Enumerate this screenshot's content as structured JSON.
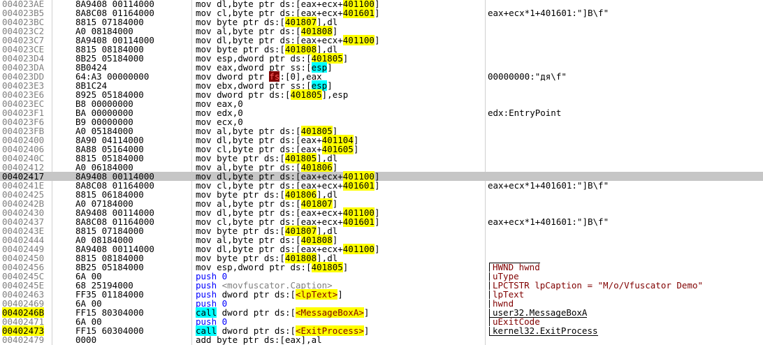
{
  "rows": [
    {
      "addr": "004023AE",
      "bytes": "8A9408 00114000",
      "mn": "mov",
      "ops": [
        [
          "reg",
          "dl"
        ],
        [
          "p",
          ","
        ],
        [
          "kw",
          "byte ptr "
        ],
        [
          "seg",
          "ds"
        ],
        [
          "p",
          ":["
        ],
        [
          "reg",
          "eax"
        ],
        [
          "p",
          "+"
        ],
        [
          "reg",
          "ecx"
        ],
        [
          "p",
          "+"
        ],
        [
          "addr",
          "401100"
        ],
        [
          "p",
          "]"
        ]
      ],
      "cmt": ""
    },
    {
      "addr": "004023B5",
      "bytes": "8A8C08 01164000",
      "mn": "mov",
      "ops": [
        [
          "reg",
          "cl"
        ],
        [
          "p",
          ","
        ],
        [
          "kw",
          "byte ptr "
        ],
        [
          "seg",
          "ds"
        ],
        [
          "p",
          ":["
        ],
        [
          "reg",
          "eax"
        ],
        [
          "p",
          "+"
        ],
        [
          "reg",
          "ecx"
        ],
        [
          "p",
          "+"
        ],
        [
          "addr",
          "401601"
        ],
        [
          "p",
          "]"
        ]
      ],
      "cmt": "eax+ecx*1+401601:\"]B\\f\""
    },
    {
      "addr": "004023BC",
      "bytes": "8815 07184000",
      "mn": "mov",
      "ops": [
        [
          "kw",
          "byte ptr "
        ],
        [
          "seg",
          "ds"
        ],
        [
          "p",
          ":["
        ],
        [
          "addr",
          "401807"
        ],
        [
          "p",
          "],"
        ],
        [
          "reg",
          "dl"
        ]
      ],
      "cmt": ""
    },
    {
      "addr": "004023C2",
      "bytes": "A0 08184000",
      "mn": "mov",
      "ops": [
        [
          "reg",
          "al"
        ],
        [
          "p",
          ","
        ],
        [
          "kw",
          "byte ptr "
        ],
        [
          "seg",
          "ds"
        ],
        [
          "p",
          ":["
        ],
        [
          "addr",
          "401808"
        ],
        [
          "p",
          "]"
        ]
      ],
      "cmt": ""
    },
    {
      "addr": "004023C7",
      "bytes": "8A9408 00114000",
      "mn": "mov",
      "ops": [
        [
          "reg",
          "dl"
        ],
        [
          "p",
          ","
        ],
        [
          "kw",
          "byte ptr "
        ],
        [
          "seg",
          "ds"
        ],
        [
          "p",
          ":["
        ],
        [
          "reg",
          "eax"
        ],
        [
          "p",
          "+"
        ],
        [
          "reg",
          "ecx"
        ],
        [
          "p",
          "+"
        ],
        [
          "addr",
          "401100"
        ],
        [
          "p",
          "]"
        ]
      ],
      "cmt": ""
    },
    {
      "addr": "004023CE",
      "bytes": "8815 08184000",
      "mn": "mov",
      "ops": [
        [
          "kw",
          "byte ptr "
        ],
        [
          "seg",
          "ds"
        ],
        [
          "p",
          ":["
        ],
        [
          "addr",
          "401808"
        ],
        [
          "p",
          "],"
        ],
        [
          "reg",
          "dl"
        ]
      ],
      "cmt": ""
    },
    {
      "addr": "004023D4",
      "bytes": "8B25 05184000",
      "mn": "mov",
      "ops": [
        [
          "reg",
          "esp"
        ],
        [
          "p",
          ","
        ],
        [
          "kw",
          "dword ptr "
        ],
        [
          "seg",
          "ds"
        ],
        [
          "p",
          ":["
        ],
        [
          "addr",
          "401805"
        ],
        [
          "p",
          "]"
        ]
      ],
      "cmt": ""
    },
    {
      "addr": "004023DA",
      "bytes": "8B0424",
      "mn": "mov",
      "ops": [
        [
          "reg",
          "eax"
        ],
        [
          "p",
          ","
        ],
        [
          "kw",
          "dword ptr "
        ],
        [
          "seg",
          "ss"
        ],
        [
          "p",
          ":["
        ],
        [
          "esphl",
          "esp"
        ],
        [
          "p",
          "]"
        ]
      ],
      "cmt": ""
    },
    {
      "addr": "004023DD",
      "bytes": "64:A3 00000000",
      "mn": "mov",
      "ops": [
        [
          "kw",
          "dword ptr "
        ],
        [
          "fs",
          "fs"
        ],
        [
          "p",
          ":[0],"
        ],
        [
          "reg",
          "eax"
        ]
      ],
      "cmt": "00000000:\"дя\\f\""
    },
    {
      "addr": "004023E3",
      "bytes": "8B1C24",
      "mn": "mov",
      "ops": [
        [
          "reg",
          "ebx"
        ],
        [
          "p",
          ","
        ],
        [
          "kw",
          "dword ptr "
        ],
        [
          "seg",
          "ss"
        ],
        [
          "p",
          ":["
        ],
        [
          "esphl",
          "esp"
        ],
        [
          "p",
          "]"
        ]
      ],
      "cmt": ""
    },
    {
      "addr": "004023E6",
      "bytes": "8925 05184000",
      "mn": "mov",
      "ops": [
        [
          "kw",
          "dword ptr "
        ],
        [
          "seg",
          "ds"
        ],
        [
          "p",
          ":["
        ],
        [
          "addr",
          "401805"
        ],
        [
          "p",
          "],"
        ],
        [
          "reg",
          "esp"
        ]
      ],
      "cmt": ""
    },
    {
      "addr": "004023EC",
      "bytes": "B8 00000000",
      "mn": "mov",
      "ops": [
        [
          "reg",
          "eax"
        ],
        [
          "p",
          ",0"
        ]
      ],
      "cmt": ""
    },
    {
      "addr": "004023F1",
      "bytes": "BA 00000000",
      "mn": "mov",
      "ops": [
        [
          "reg",
          "edx"
        ],
        [
          "p",
          ",0"
        ]
      ],
      "cmt": "edx:EntryPoint"
    },
    {
      "addr": "004023F6",
      "bytes": "B9 00000000",
      "mn": "mov",
      "ops": [
        [
          "reg",
          "ecx"
        ],
        [
          "p",
          ",0"
        ]
      ],
      "cmt": ""
    },
    {
      "addr": "004023FB",
      "bytes": "A0 05184000",
      "mn": "mov",
      "ops": [
        [
          "reg",
          "al"
        ],
        [
          "p",
          ","
        ],
        [
          "kw",
          "byte ptr "
        ],
        [
          "seg",
          "ds"
        ],
        [
          "p",
          ":["
        ],
        [
          "addr",
          "401805"
        ],
        [
          "p",
          "]"
        ]
      ],
      "cmt": ""
    },
    {
      "addr": "00402400",
      "bytes": "8A90 04114000",
      "mn": "mov",
      "ops": [
        [
          "reg",
          "dl"
        ],
        [
          "p",
          ","
        ],
        [
          "kw",
          "byte ptr "
        ],
        [
          "seg",
          "ds"
        ],
        [
          "p",
          ":["
        ],
        [
          "reg",
          "eax"
        ],
        [
          "p",
          "+"
        ],
        [
          "addr",
          "401104"
        ],
        [
          "p",
          "]"
        ]
      ],
      "cmt": ""
    },
    {
      "addr": "00402406",
      "bytes": "8A88 05164000",
      "mn": "mov",
      "ops": [
        [
          "reg",
          "cl"
        ],
        [
          "p",
          ","
        ],
        [
          "kw",
          "byte ptr "
        ],
        [
          "seg",
          "ds"
        ],
        [
          "p",
          ":["
        ],
        [
          "reg",
          "eax"
        ],
        [
          "p",
          "+"
        ],
        [
          "addr",
          "401605"
        ],
        [
          "p",
          "]"
        ]
      ],
      "cmt": ""
    },
    {
      "addr": "0040240C",
      "bytes": "8815 05184000",
      "mn": "mov",
      "ops": [
        [
          "kw",
          "byte ptr "
        ],
        [
          "seg",
          "ds"
        ],
        [
          "p",
          ":["
        ],
        [
          "addr",
          "401805"
        ],
        [
          "p",
          "],"
        ],
        [
          "reg",
          "dl"
        ]
      ],
      "cmt": ""
    },
    {
      "addr": "00402412",
      "bytes": "A0 06184000",
      "mn": "mov",
      "ops": [
        [
          "reg",
          "al"
        ],
        [
          "p",
          ","
        ],
        [
          "kw",
          "byte ptr "
        ],
        [
          "seg",
          "ds"
        ],
        [
          "p",
          ":["
        ],
        [
          "addr",
          "401806"
        ],
        [
          "p",
          "]"
        ]
      ],
      "cmt": ""
    },
    {
      "addr": "00402417",
      "bytes": "8A9408 00114000",
      "mn": "mov",
      "ops": [
        [
          "reg",
          "dl"
        ],
        [
          "p",
          ","
        ],
        [
          "kw",
          "byte ptr "
        ],
        [
          "seg",
          "ds"
        ],
        [
          "p",
          ":["
        ],
        [
          "reg",
          "eax"
        ],
        [
          "p",
          "+"
        ],
        [
          "reg",
          "ecx"
        ],
        [
          "p",
          "+"
        ],
        [
          "addr",
          "401100"
        ],
        [
          "p",
          "]"
        ]
      ],
      "cmt": "",
      "selected": true
    },
    {
      "addr": "0040241E",
      "bytes": "8A8C08 01164000",
      "mn": "mov",
      "ops": [
        [
          "reg",
          "cl"
        ],
        [
          "p",
          ","
        ],
        [
          "kw",
          "byte ptr "
        ],
        [
          "seg",
          "ds"
        ],
        [
          "p",
          ":["
        ],
        [
          "reg",
          "eax"
        ],
        [
          "p",
          "+"
        ],
        [
          "reg",
          "ecx"
        ],
        [
          "p",
          "+"
        ],
        [
          "addr",
          "401601"
        ],
        [
          "p",
          "]"
        ]
      ],
      "cmt": "eax+ecx*1+401601:\"]B\\f\""
    },
    {
      "addr": "00402425",
      "bytes": "8815 06184000",
      "mn": "mov",
      "ops": [
        [
          "kw",
          "byte ptr "
        ],
        [
          "seg",
          "ds"
        ],
        [
          "p",
          ":["
        ],
        [
          "addr",
          "401806"
        ],
        [
          "p",
          "],"
        ],
        [
          "reg",
          "dl"
        ]
      ],
      "cmt": ""
    },
    {
      "addr": "0040242B",
      "bytes": "A0 07184000",
      "mn": "mov",
      "ops": [
        [
          "reg",
          "al"
        ],
        [
          "p",
          ","
        ],
        [
          "kw",
          "byte ptr "
        ],
        [
          "seg",
          "ds"
        ],
        [
          "p",
          ":["
        ],
        [
          "addr",
          "401807"
        ],
        [
          "p",
          "]"
        ]
      ],
      "cmt": ""
    },
    {
      "addr": "00402430",
      "bytes": "8A9408 00114000",
      "mn": "mov",
      "ops": [
        [
          "reg",
          "dl"
        ],
        [
          "p",
          ","
        ],
        [
          "kw",
          "byte ptr "
        ],
        [
          "seg",
          "ds"
        ],
        [
          "p",
          ":["
        ],
        [
          "reg",
          "eax"
        ],
        [
          "p",
          "+"
        ],
        [
          "reg",
          "ecx"
        ],
        [
          "p",
          "+"
        ],
        [
          "addr",
          "401100"
        ],
        [
          "p",
          "]"
        ]
      ],
      "cmt": ""
    },
    {
      "addr": "00402437",
      "bytes": "8A8C08 01164000",
      "mn": "mov",
      "ops": [
        [
          "reg",
          "cl"
        ],
        [
          "p",
          ","
        ],
        [
          "kw",
          "byte ptr "
        ],
        [
          "seg",
          "ds"
        ],
        [
          "p",
          ":["
        ],
        [
          "reg",
          "eax"
        ],
        [
          "p",
          "+"
        ],
        [
          "reg",
          "ecx"
        ],
        [
          "p",
          "+"
        ],
        [
          "addr",
          "401601"
        ],
        [
          "p",
          "]"
        ]
      ],
      "cmt": "eax+ecx*1+401601:\"]B\\f\""
    },
    {
      "addr": "0040243E",
      "bytes": "8815 07184000",
      "mn": "mov",
      "ops": [
        [
          "kw",
          "byte ptr "
        ],
        [
          "seg",
          "ds"
        ],
        [
          "p",
          ":["
        ],
        [
          "addr",
          "401807"
        ],
        [
          "p",
          "],"
        ],
        [
          "reg",
          "dl"
        ]
      ],
      "cmt": ""
    },
    {
      "addr": "00402444",
      "bytes": "A0 08184000",
      "mn": "mov",
      "ops": [
        [
          "reg",
          "al"
        ],
        [
          "p",
          ","
        ],
        [
          "kw",
          "byte ptr "
        ],
        [
          "seg",
          "ds"
        ],
        [
          "p",
          ":["
        ],
        [
          "addr",
          "401808"
        ],
        [
          "p",
          "]"
        ]
      ],
      "cmt": ""
    },
    {
      "addr": "00402449",
      "bytes": "8A9408 00114000",
      "mn": "mov",
      "ops": [
        [
          "reg",
          "dl"
        ],
        [
          "p",
          ","
        ],
        [
          "kw",
          "byte ptr "
        ],
        [
          "seg",
          "ds"
        ],
        [
          "p",
          ":["
        ],
        [
          "reg",
          "eax"
        ],
        [
          "p",
          "+"
        ],
        [
          "reg",
          "ecx"
        ],
        [
          "p",
          "+"
        ],
        [
          "addr",
          "401100"
        ],
        [
          "p",
          "]"
        ]
      ],
      "cmt": ""
    },
    {
      "addr": "00402450",
      "bytes": "8815 08184000",
      "mn": "mov",
      "ops": [
        [
          "kw",
          "byte ptr "
        ],
        [
          "seg",
          "ds"
        ],
        [
          "p",
          ":["
        ],
        [
          "addr",
          "401808"
        ],
        [
          "p",
          "],"
        ],
        [
          "reg",
          "dl"
        ]
      ],
      "cmt": ""
    },
    {
      "addr": "00402456",
      "bytes": "8B25 05184000",
      "mn": "mov",
      "ops": [
        [
          "reg",
          "esp"
        ],
        [
          "p",
          ","
        ],
        [
          "kw",
          "dword ptr "
        ],
        [
          "seg",
          "ds"
        ],
        [
          "p",
          ":["
        ],
        [
          "addr",
          "401805"
        ],
        [
          "p",
          "]"
        ]
      ],
      "cmt": "HWND hwnd",
      "cmtType": "arg-start"
    },
    {
      "addr": "0040245C",
      "bytes": "6A 00",
      "mn": "push",
      "ops": [
        [
          "p",
          "0"
        ]
      ],
      "cmt": "uType",
      "cmtType": "arg"
    },
    {
      "addr": "0040245E",
      "bytes": "68 25194000",
      "mn": "push",
      "ops": [
        [
          "caption",
          "<movfuscator.Caption>"
        ]
      ],
      "cmt": "LPCTSTR lpCaption = \"M/o/Vfuscator Demo\"",
      "cmtType": "arg"
    },
    {
      "addr": "00402463",
      "bytes": "FF35 01184000",
      "mn": "push",
      "ops": [
        [
          "kw",
          "dword ptr "
        ],
        [
          "seg",
          "ds"
        ],
        [
          "p",
          ":["
        ],
        [
          "addrsym",
          "<lpText>"
        ],
        [
          "p",
          "]"
        ]
      ],
      "cmt": "lpText",
      "cmtType": "arg"
    },
    {
      "addr": "00402469",
      "bytes": "6A 00",
      "mn": "push",
      "ops": [
        [
          "p",
          "0"
        ]
      ],
      "cmt": "hwnd",
      "cmtType": "arg"
    },
    {
      "addr": "0040246B",
      "bytes": "FF15 80304000",
      "mn": "call",
      "ops": [
        [
          "kw",
          "dword ptr "
        ],
        [
          "seg",
          "ds"
        ],
        [
          "p",
          ":["
        ],
        [
          "addrsym",
          "<MessageBoxA>"
        ],
        [
          "p",
          "]"
        ]
      ],
      "cmt": "user32.MessageBoxA",
      "cmtType": "arg-end",
      "addrHl": true
    },
    {
      "addr": "00402471",
      "bytes": "6A 00",
      "mn": "push",
      "ops": [
        [
          "p",
          "0"
        ]
      ],
      "cmt": "uExitCode",
      "cmtType": "arg-start"
    },
    {
      "addr": "00402473",
      "bytes": "FF15 60304000",
      "mn": "call",
      "ops": [
        [
          "kw",
          "dword ptr "
        ],
        [
          "seg",
          "ds"
        ],
        [
          "p",
          ":["
        ],
        [
          "addrsym",
          "<ExitProcess>"
        ],
        [
          "p",
          "]"
        ]
      ],
      "cmt": "kernel32.ExitProcess",
      "cmtType": "arg-end",
      "addrHl": true
    },
    {
      "addr": "00402479",
      "bytes": "0000",
      "mn": "add",
      "ops": [
        [
          "kw",
          "byte ptr "
        ],
        [
          "seg",
          "ds"
        ],
        [
          "p",
          ":["
        ],
        [
          "reg",
          "eax"
        ],
        [
          "p",
          "],"
        ],
        [
          "reg",
          "al"
        ]
      ],
      "cmt": ""
    }
  ]
}
